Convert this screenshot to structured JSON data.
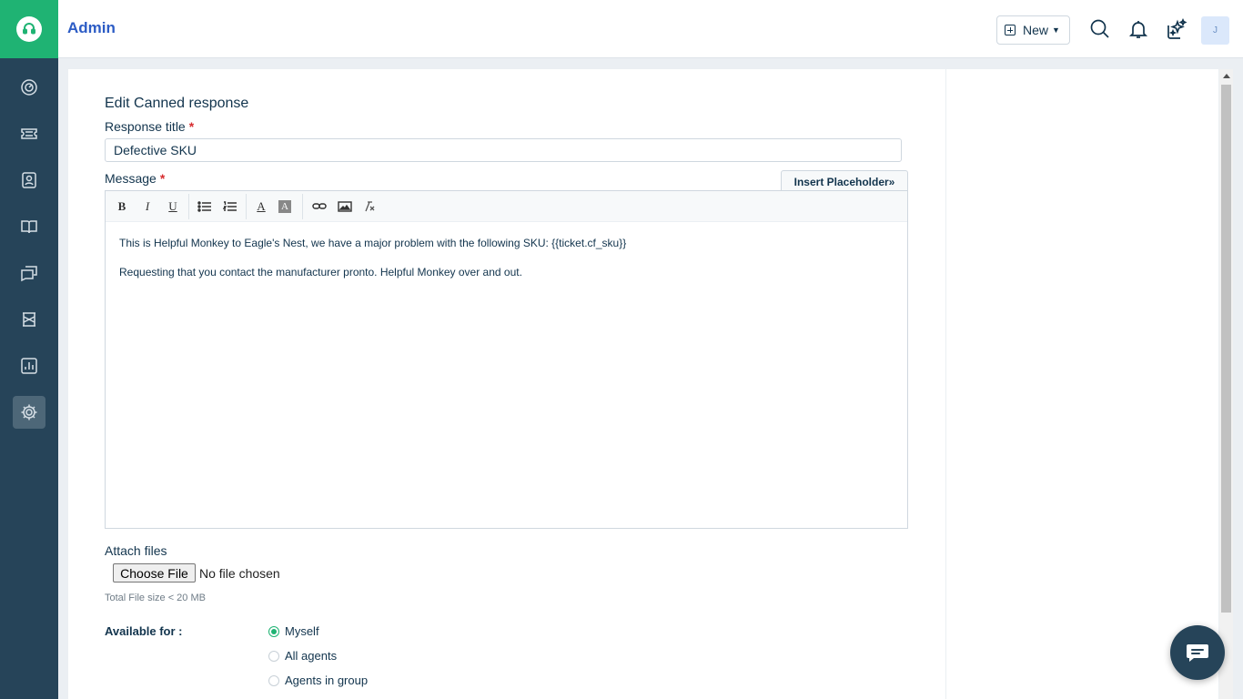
{
  "header": {
    "title": "Admin",
    "new_label": "New",
    "avatar_initial": "J"
  },
  "sidebar": {
    "items": [
      {
        "icon": "dashboard-icon"
      },
      {
        "icon": "tickets-icon"
      },
      {
        "icon": "contacts-icon"
      },
      {
        "icon": "solutions-icon"
      },
      {
        "icon": "discussions-icon"
      },
      {
        "icon": "assets-icon"
      },
      {
        "icon": "reports-icon"
      },
      {
        "icon": "settings-icon",
        "active": true
      }
    ]
  },
  "form": {
    "heading": "Edit Canned response",
    "title_label": "Response title",
    "title_value": "Defective SKU",
    "message_label": "Message",
    "required_mark": "*",
    "insert_placeholder_label": "Insert Placeholder»",
    "message_lines": [
      "This is Helpful Monkey to Eagle's Nest, we have a major problem with the following SKU: {{ticket.cf_sku}}",
      "Requesting that you contact the manufacturer pronto. Helpful Monkey over and out."
    ],
    "toolbar": {
      "bold": "B",
      "italic": "I",
      "underline": "U",
      "font_color": "A",
      "bg_color": "A"
    },
    "attach_label": "Attach files",
    "choose_file_label": "Choose File",
    "no_file_text": "No file chosen",
    "file_size_hint": "Total File size < 20 MB",
    "available_label": "Available for :",
    "available_options": [
      {
        "label": "Myself",
        "checked": true
      },
      {
        "label": "All agents",
        "checked": false
      },
      {
        "label": "Agents in group",
        "checked": false
      }
    ]
  },
  "colors": {
    "sidebar_bg": "#264459",
    "brand_green": "#1fb373",
    "title_blue": "#2c5cc5"
  }
}
